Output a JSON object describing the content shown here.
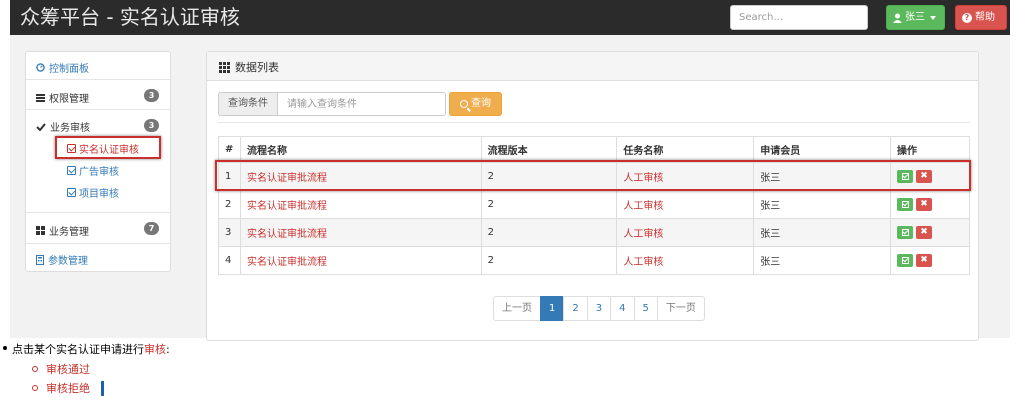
{
  "navbar": {
    "brand": "众筹平台 - 实名认证审核",
    "search_placeholder": "Search...",
    "user_label": "张三",
    "help_label": "帮助"
  },
  "sidebar": {
    "items": [
      {
        "label": "控制面板"
      },
      {
        "label": "权限管理",
        "badge": "3"
      },
      {
        "label": "业务审核",
        "badge": "3"
      },
      {
        "label": "业务管理",
        "badge": "7"
      },
      {
        "label": "参数管理"
      }
    ],
    "sub_items": [
      {
        "label": "实名认证审核"
      },
      {
        "label": "广告审核"
      },
      {
        "label": "项目审核"
      }
    ]
  },
  "panel": {
    "title": "数据列表",
    "query_label": "查询条件",
    "query_placeholder": "请输入查询条件",
    "query_button": "查询"
  },
  "table": {
    "headers": [
      "#",
      "流程名称",
      "流程版本",
      "任务名称",
      "申请会员",
      "操作"
    ],
    "rows": [
      [
        "1",
        "实名认证审批流程",
        "2",
        "人工审核",
        "张三"
      ],
      [
        "2",
        "实名认证审批流程",
        "2",
        "人工审核",
        "张三"
      ],
      [
        "3",
        "实名认证审批流程",
        "2",
        "人工审核",
        "张三"
      ],
      [
        "4",
        "实名认证审批流程",
        "2",
        "人工审核",
        "张三"
      ]
    ],
    "delete_glyph": "✖"
  },
  "pager": {
    "prev": "上一页",
    "pages": [
      "1",
      "2",
      "3",
      "4",
      "5"
    ],
    "next": "下一页",
    "active": "1"
  },
  "notes": {
    "main_prefix": "点击某个实名认证申请进行",
    "main_highlight": "审核",
    "main_suffix": ":",
    "sub": [
      "审核通过",
      "审核拒绝"
    ]
  },
  "colors": {
    "navbar_bg": "#2b2b2b",
    "success": "#5cb85c",
    "danger": "#d9534f",
    "warning": "#f0ad4e",
    "primary": "#337ab7",
    "highlight_red": "#c9302c"
  }
}
